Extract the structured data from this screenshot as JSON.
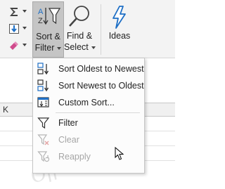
{
  "ribbon": {
    "sort_filter": {
      "line1": "Sort &",
      "line2": "Filter"
    },
    "find_select": {
      "line1": "Find &",
      "line2": "Select"
    },
    "ideas": {
      "label": "Ideas"
    },
    "small_buttons": [
      "autosum-icon",
      "fill-icon",
      "clear-icon"
    ]
  },
  "sheet": {
    "column_header": "K",
    "watermark": "OfficeTuts"
  },
  "menu": {
    "items": [
      {
        "label": "Sort Oldest to Newest",
        "icon": "sort-oldest-to-newest-icon",
        "enabled": true
      },
      {
        "label": "Sort Newest to Oldest",
        "icon": "sort-newest-to-oldest-icon",
        "enabled": true
      },
      {
        "label": "Custom Sort...",
        "icon": "custom-sort-icon",
        "enabled": true
      },
      {
        "label": "Filter",
        "icon": "filter-icon",
        "enabled": true
      },
      {
        "label": "Clear",
        "icon": "clear-filter-icon",
        "enabled": false
      },
      {
        "label": "Reapply",
        "icon": "reapply-icon",
        "enabled": false
      }
    ]
  },
  "colors": {
    "accent_blue": "#1e6fc5",
    "highlight": "#c5c5c5",
    "disabled_text": "#a6a6a6"
  }
}
